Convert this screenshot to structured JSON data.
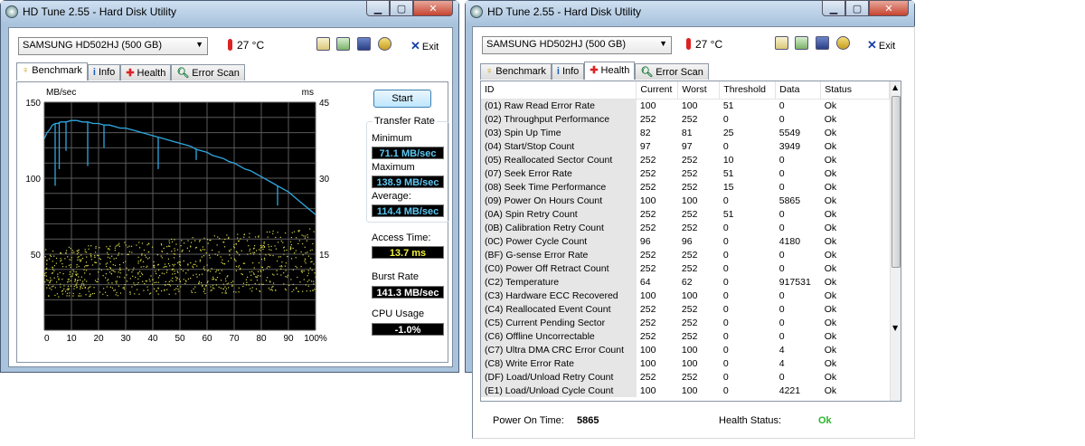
{
  "left_window": {
    "title": "HD Tune 2.55 - Hard Disk Utility",
    "drive": "SAMSUNG HD502HJ (500 GB)",
    "temperature": "27 °C",
    "exit_label": "Exit",
    "tabs": [
      {
        "label": "Benchmark",
        "icon": "benchmark-icon",
        "active": true
      },
      {
        "label": "Info",
        "icon": "info-icon",
        "active": false
      },
      {
        "label": "Health",
        "icon": "health-icon",
        "active": false
      },
      {
        "label": "Error Scan",
        "icon": "error-scan-icon",
        "active": false
      }
    ],
    "start_button": "Start",
    "transfer_rate_title": "Transfer Rate",
    "minimum_label": "Minimum",
    "minimum_value": "71.1 MB/sec",
    "maximum_label": "Maximum",
    "maximum_value": "138.9 MB/sec",
    "average_label": "Average:",
    "average_value": "114.4 MB/sec",
    "access_time_label": "Access Time:",
    "access_time_value": "13.7 ms",
    "burst_rate_label": "Burst Rate",
    "burst_rate_value": "141.3 MB/sec",
    "cpu_usage_label": "CPU Usage",
    "cpu_usage_value": "-1.0%"
  },
  "chart_data": {
    "type": "line",
    "ylabel_left": "MB/sec",
    "ylabel_right": "ms",
    "y_left_ticks": [
      "150",
      "100",
      "50"
    ],
    "y_right_ticks": [
      "45",
      "30",
      "15"
    ],
    "ylim_left": [
      0,
      150
    ],
    "ylim_right": [
      0,
      45
    ],
    "x_ticks": [
      "0",
      "10",
      "20",
      "30",
      "40",
      "50",
      "60",
      "70",
      "80",
      "90",
      "100%"
    ],
    "xlim": [
      0,
      100
    ],
    "grid": true,
    "colors": {
      "transfer": "#2fa8e0",
      "access": "#d8d84a",
      "grid": "#5a5a5a",
      "background": "#000000"
    },
    "series": [
      {
        "type": "line",
        "x": [
          0,
          1,
          2,
          3,
          4,
          5,
          6,
          8,
          10,
          12,
          14,
          16,
          18,
          20,
          22,
          24,
          26,
          28,
          30,
          32,
          34,
          36,
          38,
          40,
          42,
          44,
          46,
          48,
          50,
          52,
          54,
          56,
          58,
          60,
          62,
          64,
          66,
          68,
          70,
          72,
          74,
          76,
          78,
          80,
          82,
          84,
          86,
          88,
          90,
          92,
          94,
          96,
          98,
          100
        ],
        "y": [
          126,
          130,
          132,
          135,
          136,
          136,
          137,
          137,
          138,
          138,
          137,
          137,
          136,
          136,
          135,
          135,
          134,
          133,
          133,
          132,
          131,
          130,
          129,
          128,
          127,
          126,
          125,
          124,
          123,
          122,
          121,
          119,
          118,
          117,
          115,
          114,
          113,
          111,
          110,
          108,
          106,
          105,
          103,
          101,
          99,
          97,
          95,
          93,
          91,
          88,
          85,
          82,
          79,
          76
        ]
      },
      {
        "type": "scatter",
        "x_range": [
          0,
          100
        ],
        "y_start": [
          22,
          54
        ],
        "y_end": [
          26,
          68
        ]
      }
    ]
  },
  "right_window": {
    "title": "HD Tune 2.55 - Hard Disk Utility",
    "drive": "SAMSUNG HD502HJ (500 GB)",
    "temperature": "27 °C",
    "exit_label": "Exit",
    "tabs": [
      {
        "label": "Benchmark",
        "icon": "benchmark-icon",
        "active": false
      },
      {
        "label": "Info",
        "icon": "info-icon",
        "active": false
      },
      {
        "label": "Health",
        "icon": "health-icon",
        "active": true
      },
      {
        "label": "Error Scan",
        "icon": "error-scan-icon",
        "active": false
      }
    ],
    "columns": [
      "ID",
      "Current",
      "Worst",
      "Threshold",
      "Data",
      "Status"
    ],
    "rows": [
      [
        "(01) Raw Read Error Rate",
        "100",
        "100",
        "51",
        "0",
        "Ok"
      ],
      [
        "(02) Throughput Performance",
        "252",
        "252",
        "0",
        "0",
        "Ok"
      ],
      [
        "(03) Spin Up Time",
        "82",
        "81",
        "25",
        "5549",
        "Ok"
      ],
      [
        "(04) Start/Stop Count",
        "97",
        "97",
        "0",
        "3949",
        "Ok"
      ],
      [
        "(05) Reallocated Sector Count",
        "252",
        "252",
        "10",
        "0",
        "Ok"
      ],
      [
        "(07) Seek Error Rate",
        "252",
        "252",
        "51",
        "0",
        "Ok"
      ],
      [
        "(08) Seek Time Performance",
        "252",
        "252",
        "15",
        "0",
        "Ok"
      ],
      [
        "(09) Power On Hours Count",
        "100",
        "100",
        "0",
        "5865",
        "Ok"
      ],
      [
        "(0A) Spin Retry Count",
        "252",
        "252",
        "51",
        "0",
        "Ok"
      ],
      [
        "(0B) Calibration Retry Count",
        "252",
        "252",
        "0",
        "0",
        "Ok"
      ],
      [
        "(0C) Power Cycle Count",
        "96",
        "96",
        "0",
        "4180",
        "Ok"
      ],
      [
        "(BF) G-sense Error Rate",
        "252",
        "252",
        "0",
        "0",
        "Ok"
      ],
      [
        "(C0) Power Off Retract Count",
        "252",
        "252",
        "0",
        "0",
        "Ok"
      ],
      [
        "(C2) Temperature",
        "64",
        "62",
        "0",
        "917531",
        "Ok"
      ],
      [
        "(C3) Hardware ECC Recovered",
        "100",
        "100",
        "0",
        "0",
        "Ok"
      ],
      [
        "(C4) Reallocated Event Count",
        "252",
        "252",
        "0",
        "0",
        "Ok"
      ],
      [
        "(C5) Current Pending Sector",
        "252",
        "252",
        "0",
        "0",
        "Ok"
      ],
      [
        "(C6) Offline Uncorrectable",
        "252",
        "252",
        "0",
        "0",
        "Ok"
      ],
      [
        "(C7) Ultra DMA CRC Error Count",
        "100",
        "100",
        "0",
        "4",
        "Ok"
      ],
      [
        "(C8) Write Error Rate",
        "100",
        "100",
        "0",
        "4",
        "Ok"
      ],
      [
        "(DF) Load/Unload Retry Count",
        "252",
        "252",
        "0",
        "0",
        "Ok"
      ],
      [
        "(E1) Load/Unload Cycle Count",
        "100",
        "100",
        "0",
        "4221",
        "Ok"
      ]
    ],
    "power_on_time_label": "Power On Time:",
    "power_on_time_value": "5865",
    "health_status_label": "Health Status:",
    "health_status_value": "Ok",
    "health_status_color": "#2db52d"
  }
}
